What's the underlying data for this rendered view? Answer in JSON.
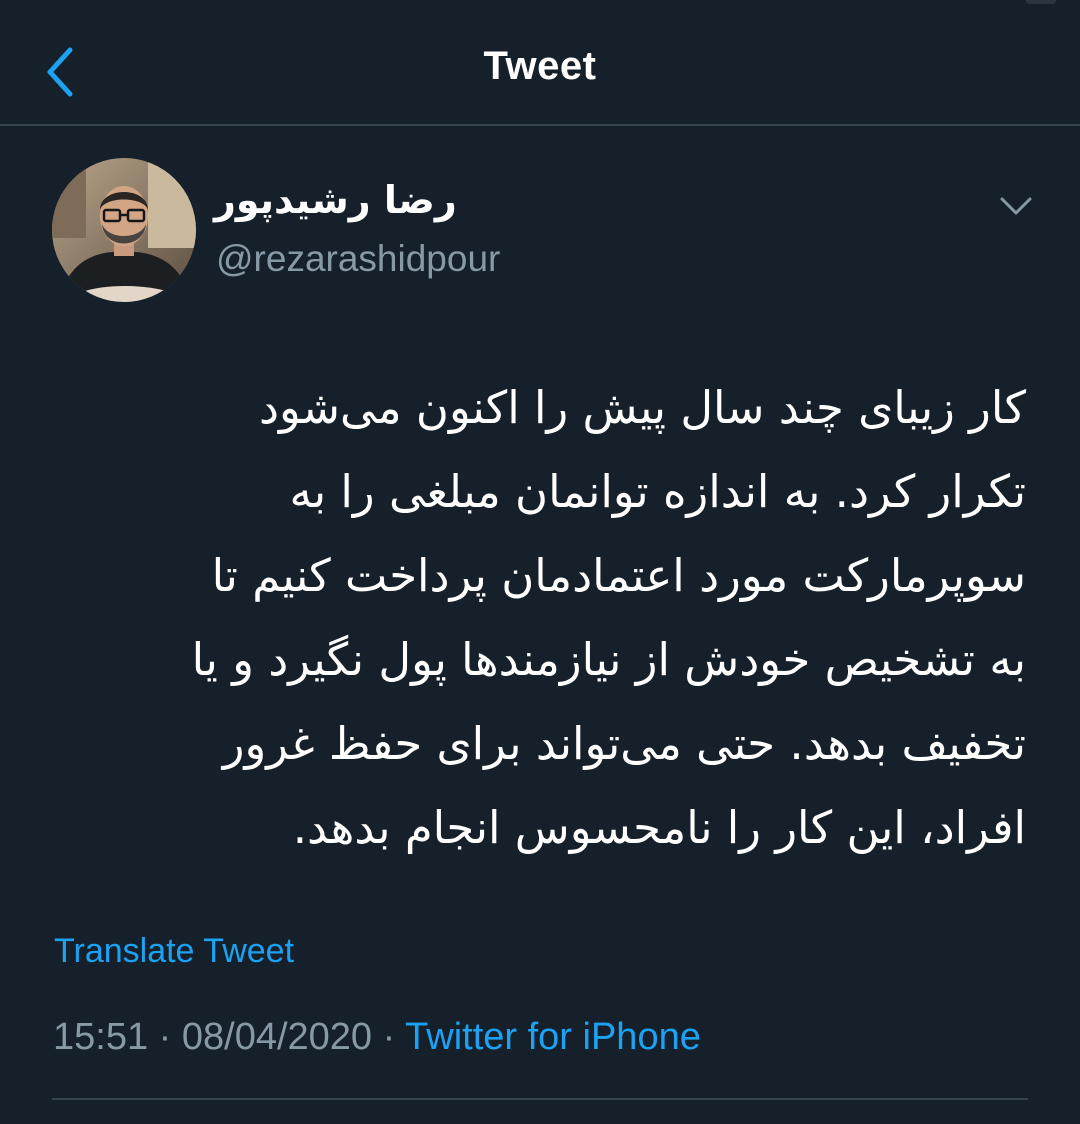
{
  "header": {
    "title": "Tweet",
    "back_icon": "chevron-left-icon"
  },
  "colors": {
    "background": "#15202b",
    "accent": "#1da1f2",
    "secondary_text": "#8899a6",
    "divider": "#38444d"
  },
  "author": {
    "display_name": "رضا رشیدپور",
    "handle": "@rezarashidpour",
    "avatar": "avatar-photo"
  },
  "more_icon": "chevron-down-icon",
  "tweet": {
    "lines": [
      "کار زیبای چند سال پیش را اکنون می‌شود",
      "تکرار کرد. به اندازه توانمان مبلغی را به",
      "سوپرمارکت مورد اعتمادمان پرداخت کنیم تا",
      "به تشخیص خودش از نیازمندها پول نگیرد و یا",
      "تخفیف بدهد. حتی می‌تواند برای حفظ غرور",
      "افراد، این کار را نامحسوس انجام بدهد."
    ]
  },
  "translate_label": "Translate Tweet",
  "meta": {
    "time": "15:51",
    "separator": "·",
    "date": "08/04/2020",
    "source": "Twitter for iPhone"
  }
}
